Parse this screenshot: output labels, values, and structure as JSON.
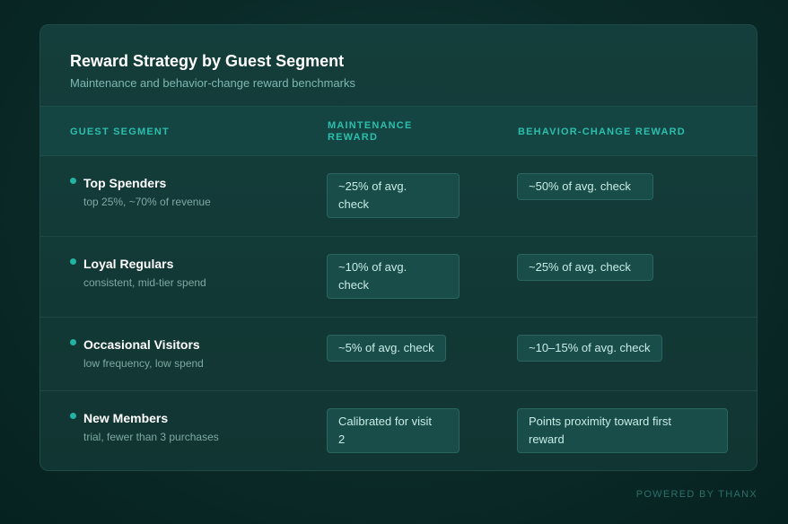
{
  "card": {
    "title": "Reward Strategy by Guest Segment",
    "subtitle": "Maintenance and behavior-change reward benchmarks"
  },
  "table": {
    "headers": {
      "segment": "GUEST SEGMENT",
      "maintenance_line1": "MAINTENANCE",
      "maintenance_line2": "REWARD",
      "behavior": "BEHAVIOR-CHANGE REWARD"
    },
    "rows": [
      {
        "name": "Top Spenders",
        "description": "top 25%, ~70% of revenue",
        "maintenance_line1": "~25% of avg.",
        "maintenance_line2": "check",
        "behavior_line1": "~50% of avg. check",
        "behavior_line2": ""
      },
      {
        "name": "Loyal Regulars",
        "description": "consistent, mid-tier spend",
        "maintenance_line1": "~10% of avg.",
        "maintenance_line2": "check",
        "behavior_line1": "~25% of avg. check",
        "behavior_line2": ""
      },
      {
        "name": "Occasional Visitors",
        "description": "low frequency, low spend",
        "maintenance_line1": "~5% of avg. check",
        "maintenance_line2": "",
        "behavior_line1": "~10–15% of avg. check",
        "behavior_line2": ""
      },
      {
        "name": "New Members",
        "description": "trial, fewer than 3 purchases",
        "maintenance_line1": "Calibrated for visit",
        "maintenance_line2": "2",
        "behavior_line1": "Points proximity toward first",
        "behavior_line2": "reward"
      }
    ]
  },
  "footer": {
    "text": "POWERED BY THANX"
  },
  "colors": {
    "accent": "#22b3a3",
    "header_text": "#2bbfae",
    "background": "#0a2a28"
  }
}
